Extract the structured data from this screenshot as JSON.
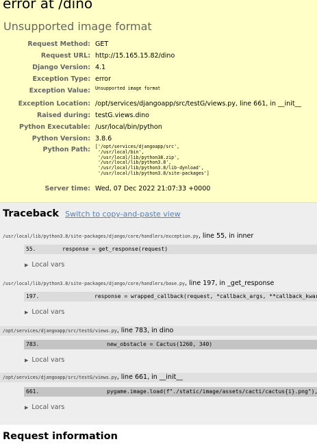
{
  "summary": {
    "title": "error at /dino",
    "subtitle": "Unsupported image format",
    "rows": {
      "method": {
        "key": "Request Method:",
        "val": "GET"
      },
      "url": {
        "key": "Request URL:",
        "val": "http://15.165.15.82/dino"
      },
      "django": {
        "key": "Django Version:",
        "val": "4.1"
      },
      "exc_type": {
        "key": "Exception Type:",
        "val": "error"
      },
      "exc_val": {
        "key": "Exception Value:",
        "val": "Unsupported image format"
      },
      "exc_loc": {
        "key": "Exception Location:",
        "val": "/opt/services/djangoapp/src/testG/views.py, line 661, in __init__"
      },
      "raised": {
        "key": "Raised during:",
        "val": "testG.views.dino"
      },
      "exe": {
        "key": "Python Executable:",
        "val": "/usr/local/bin/python"
      },
      "pyver": {
        "key": "Python Version:",
        "val": "3.8.6"
      },
      "pypath": {
        "key": "Python Path:",
        "val": "['/opt/services/djangoapp/src',\n '/usr/local/bin',\n '/usr/local/lib/python38.zip',\n '/usr/local/lib/python3.8',\n '/usr/local/lib/python3.8/lib-dynload',\n '/usr/local/lib/python3.8/site-packages']"
      },
      "time": {
        "key": "Server time:",
        "val": "Wed, 07 Dec 2022 21:07:33 +0000"
      }
    }
  },
  "traceback": {
    "title": "Traceback",
    "switch_link": "Switch to copy-and-paste view",
    "local_vars_label": "Local vars",
    "frames": [
      {
        "file": "/usr/local/lib/python3.8/site-packages/django/core/handlers/exception.py",
        "loc": ", line 55, in inner",
        "lineno": "55.",
        "code": "response = get_response(request)"
      },
      {
        "file": "/usr/local/lib/python3.8/site-packages/django/core/handlers/base.py",
        "loc": ", line 197, in _get_response",
        "lineno": "197.",
        "code": "response = wrapped_callback(request, *callback_args, **callback_kwargs)"
      },
      {
        "file": "/opt/services/djangoapp/src/testG/views.py",
        "loc": ", line 783, in dino",
        "lineno": "783.",
        "code": "new_obstacle = Cactus(1260, 340)"
      },
      {
        "file": "/opt/services/djangoapp/src/testG/views.py",
        "loc": ", line 661, in __init__",
        "lineno": "661.",
        "code": "pygame.image.load(f\"./static/image/assets/cacti/cactus{i}.png\"),"
      }
    ]
  },
  "request_info": {
    "title": "Request information"
  }
}
